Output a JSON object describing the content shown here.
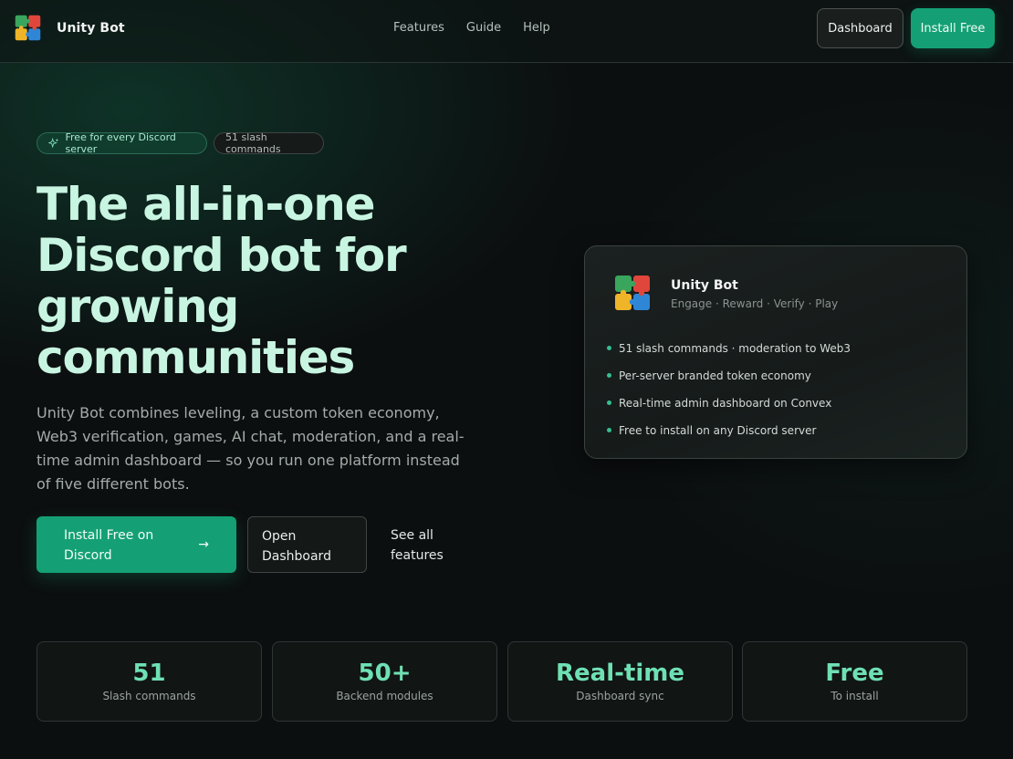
{
  "brand": {
    "name": "Unity Bot",
    "logo_icon": "puzzle-icon"
  },
  "nav": {
    "links": [
      "Features",
      "Guide",
      "Help"
    ],
    "dashboard_label": "Dashboard",
    "install_label": "Install Free"
  },
  "badges": {
    "free": "Free for every Discord server",
    "commands": "51 slash commands"
  },
  "hero": {
    "title_lines": [
      "The all-in-one",
      "Discord bot for",
      "growing",
      "communities"
    ],
    "description": "Unity Bot combines leveling, a custom token economy, Web3 verification, games, AI chat, moderation, and a real-time admin dashboard — so you run one platform instead of five different bots.",
    "cta_primary": "Install Free on Discord",
    "cta_primary_arrow": "→",
    "cta_secondary": "Open Dashboard",
    "cta_link": "See all features"
  },
  "card": {
    "title": "Unity Bot",
    "subtitle": "Engage · Reward · Verify · Play",
    "features": [
      "51 slash commands · moderation to Web3",
      "Per-server branded token economy",
      "Real-time admin dashboard on Convex",
      "Free to install on any Discord server"
    ]
  },
  "stats": [
    {
      "value": "51",
      "label": "Slash commands"
    },
    {
      "value": "50+",
      "label": "Backend modules"
    },
    {
      "value": "Real-time",
      "label": "Dashboard sync"
    },
    {
      "value": "Free",
      "label": "To install"
    }
  ],
  "colors": {
    "accent": "#14a074",
    "accent_text": "#6fe0b4",
    "title": "#c8f5e2",
    "background": "#0c0f10"
  }
}
